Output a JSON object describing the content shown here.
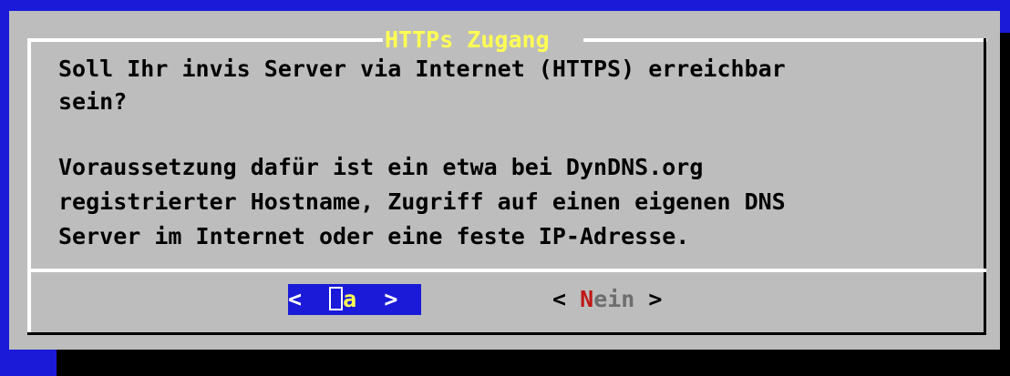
{
  "dialog": {
    "title": "HTTPs Zugang",
    "lines": [
      "Soll Ihr invis Server via Internet (HTTPS) erreichbar",
      "sein?",
      "",
      "Voraussetzung dafür ist ein etwa bei DynDNS.org",
      "registrierter Hostname, Zugriff auf einen eigenen DNS",
      "Server im Internet oder eine feste IP-Adresse."
    ]
  },
  "buttons": {
    "yes": {
      "left_arrow": "<",
      "hotkey": "J",
      "rest": "a",
      "right_arrow": ">",
      "selected": true
    },
    "no": {
      "left_arrow": "<",
      "hotkey": "N",
      "rest": "ein",
      "right_arrow": ">",
      "selected": false
    }
  },
  "colors": {
    "background": "#1a1ad8",
    "dialog": "#bdbdbd",
    "title": "#ffff54",
    "hotkey_unselected": "#c01818"
  }
}
